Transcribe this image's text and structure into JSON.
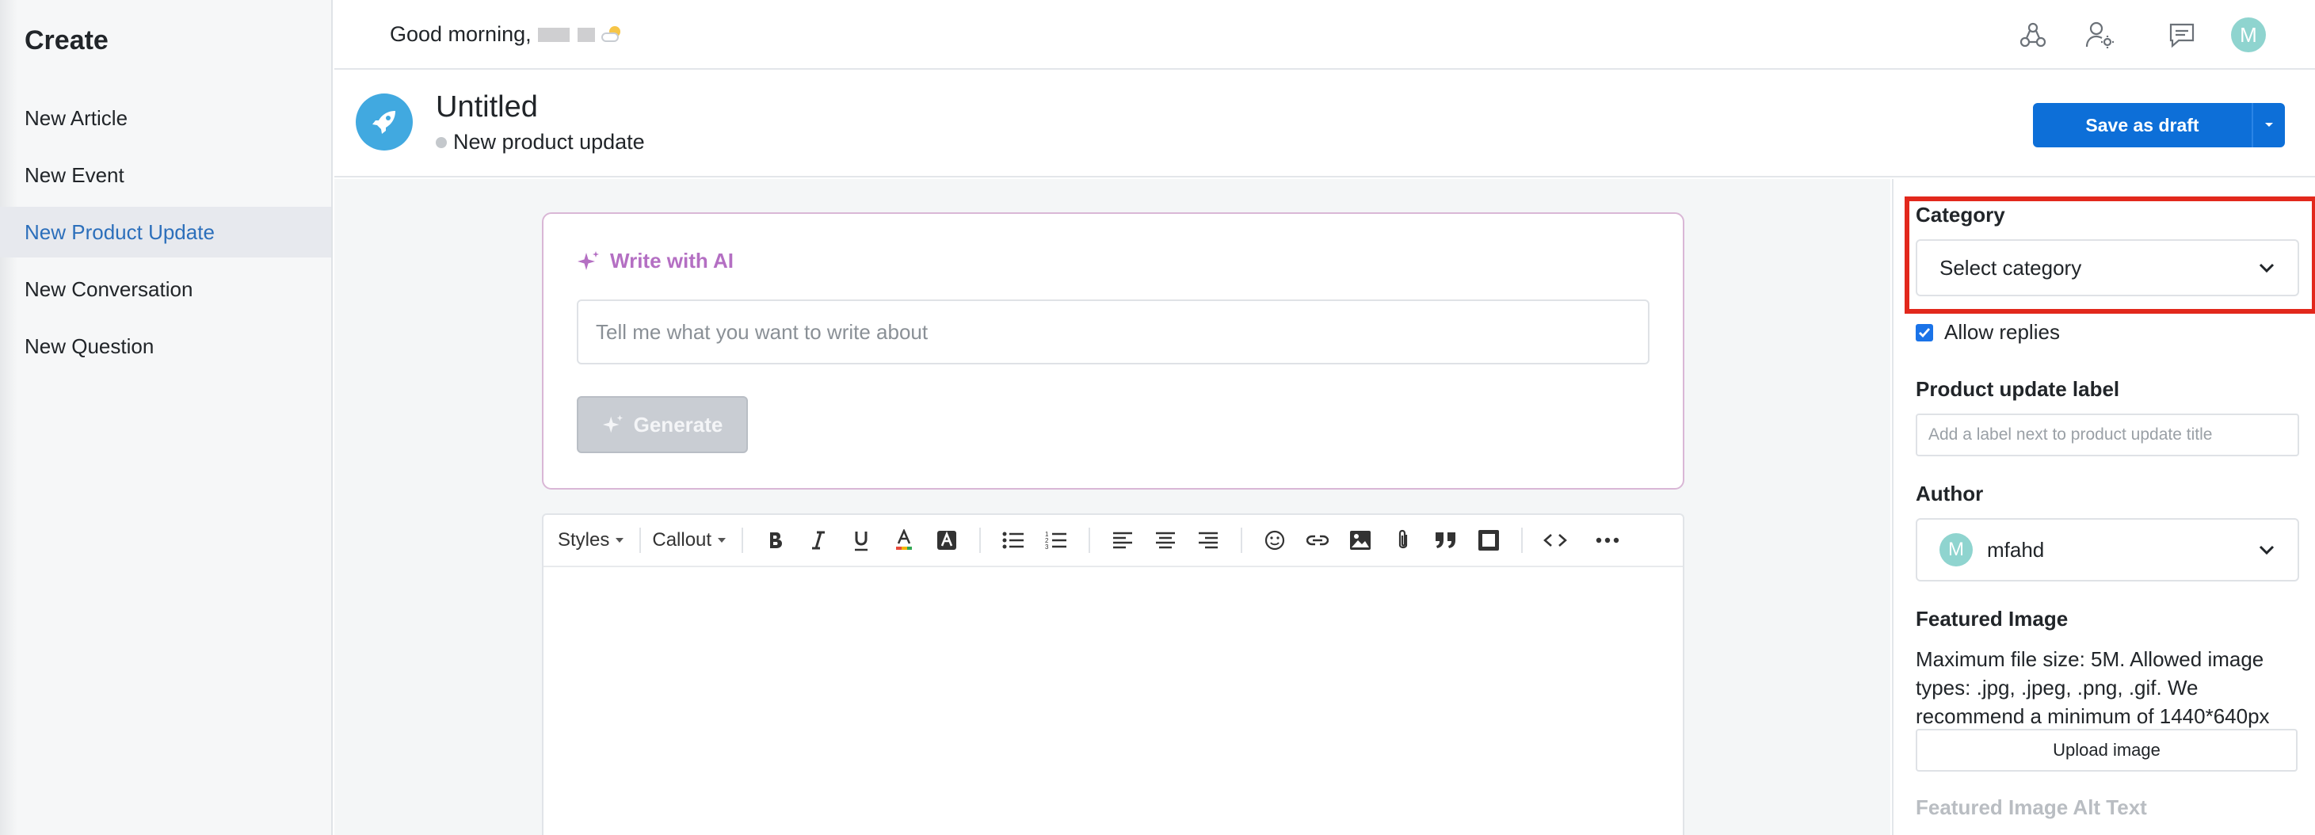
{
  "sidebar": {
    "title": "Create",
    "items": [
      {
        "label": "New Article",
        "active": false
      },
      {
        "label": "New Event",
        "active": false
      },
      {
        "label": "New Product Update",
        "active": true
      },
      {
        "label": "New Conversation",
        "active": false
      },
      {
        "label": "New Question",
        "active": false
      }
    ]
  },
  "topbar": {
    "greeting": "Good morning,",
    "icons": [
      "community-icon",
      "user-settings-icon",
      "chat-icon",
      "avatar"
    ],
    "avatar_initial": "M"
  },
  "header": {
    "title": "Untitled",
    "subtitle": "New product update",
    "save_label": "Save as draft"
  },
  "ai": {
    "title": "Write with AI",
    "placeholder": "Tell me what you want to write about",
    "generate_label": "Generate"
  },
  "editor": {
    "styles_label": "Styles",
    "callout_label": "Callout"
  },
  "panel": {
    "category_label": "Category",
    "category_value": "Select category",
    "allow_replies_label": "Allow replies",
    "allow_replies_checked": true,
    "product_label_label": "Product update label",
    "product_label_placeholder": "Add a label next to product update title",
    "author_label": "Author",
    "author_initial": "M",
    "author_name": "mfahd",
    "featured_image_label": "Featured Image",
    "featured_image_help": "Maximum file size: 5M. Allowed image types: .jpg, .jpeg, .png, .gif. We recommend a minimum of 1440*640px",
    "upload_label": "Upload image",
    "alt_text_label": "Featured Image Alt Text"
  },
  "colors": {
    "primary": "#0d6fd8",
    "active_nav": "#2c6fbb",
    "ai_accent": "#b46fc3",
    "highlight": "#e2281c",
    "rocket_bg": "#41a9e0"
  }
}
